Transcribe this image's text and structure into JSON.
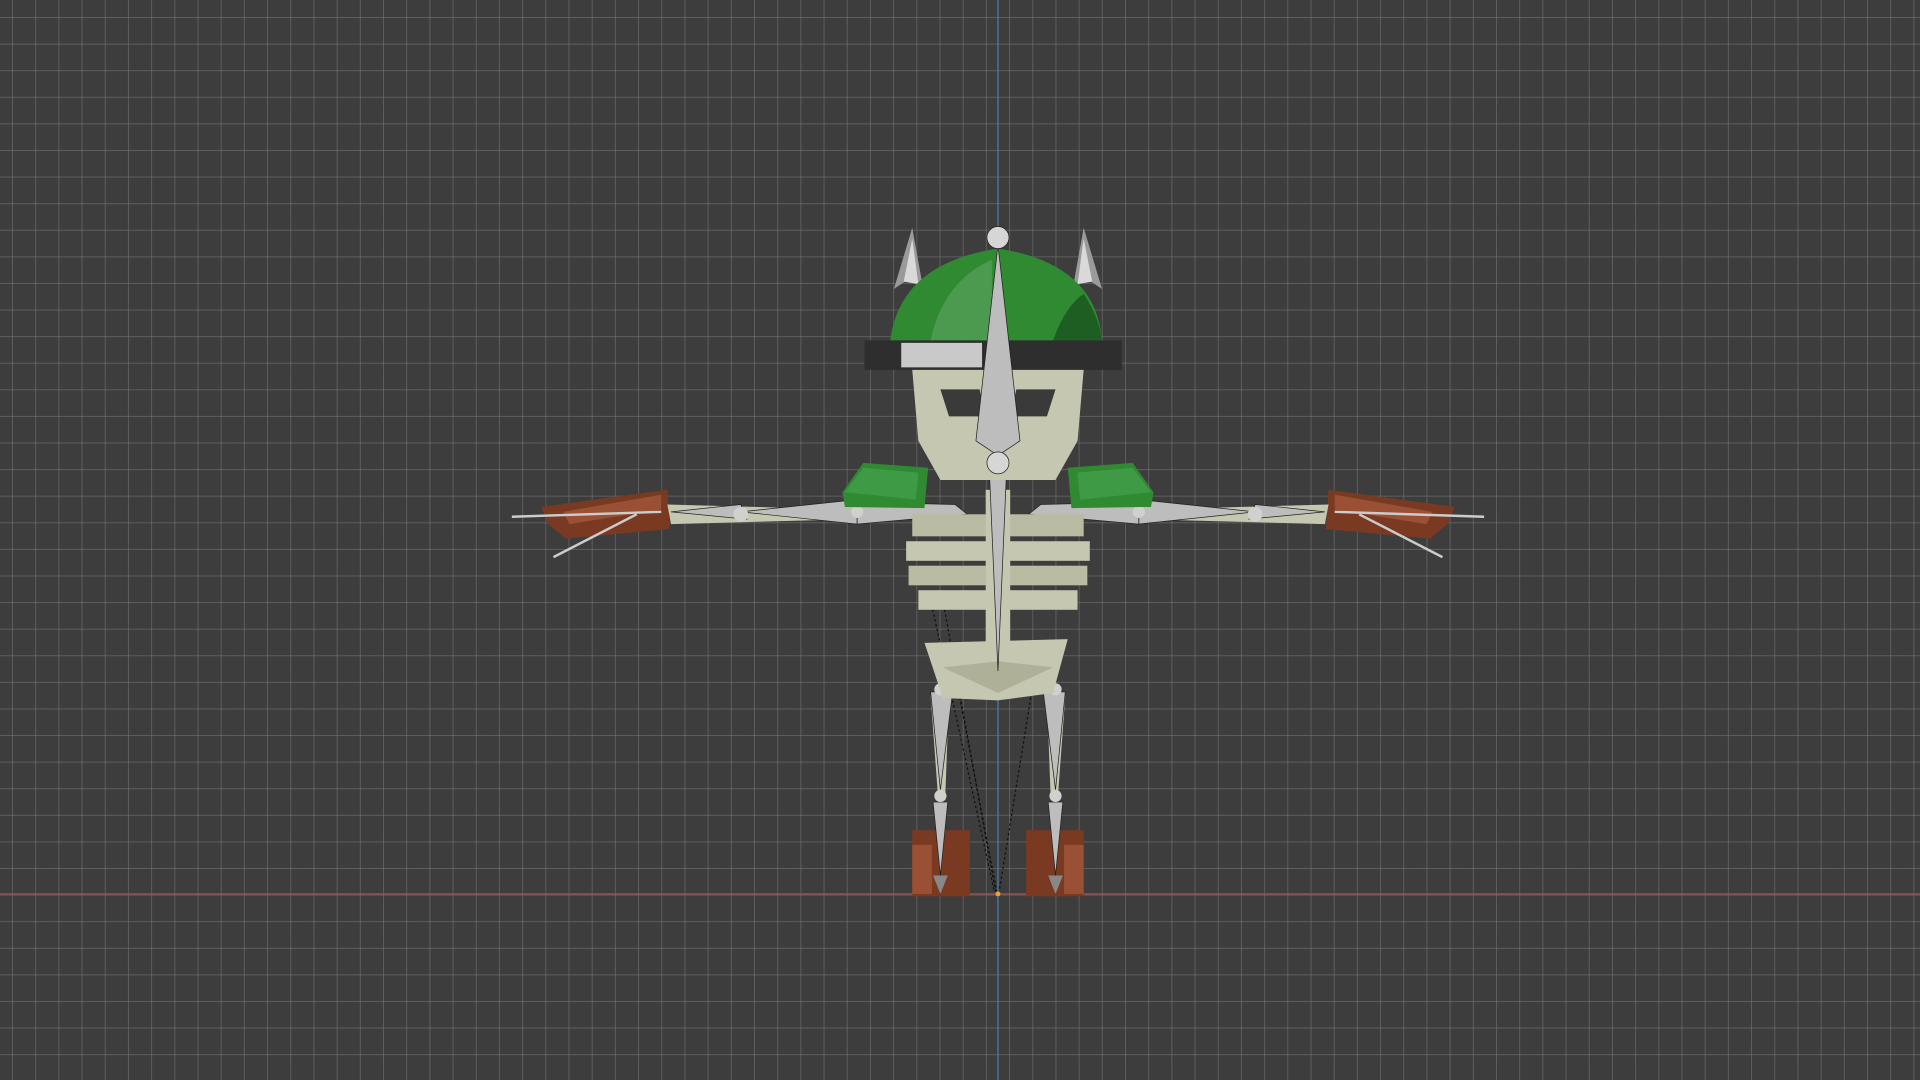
{
  "viewport": {
    "view": "front-orthographic",
    "object": "skeleton-armature-character",
    "colors": {
      "background": "#3d3d3d",
      "grid": "#555555",
      "x_axis": "#b04848",
      "z_axis": "#4a7db5",
      "helmet": "#2f8a32",
      "bone": "#c5c7b0",
      "armature": "#bdbdbd",
      "wood": "#7a3a22"
    }
  }
}
